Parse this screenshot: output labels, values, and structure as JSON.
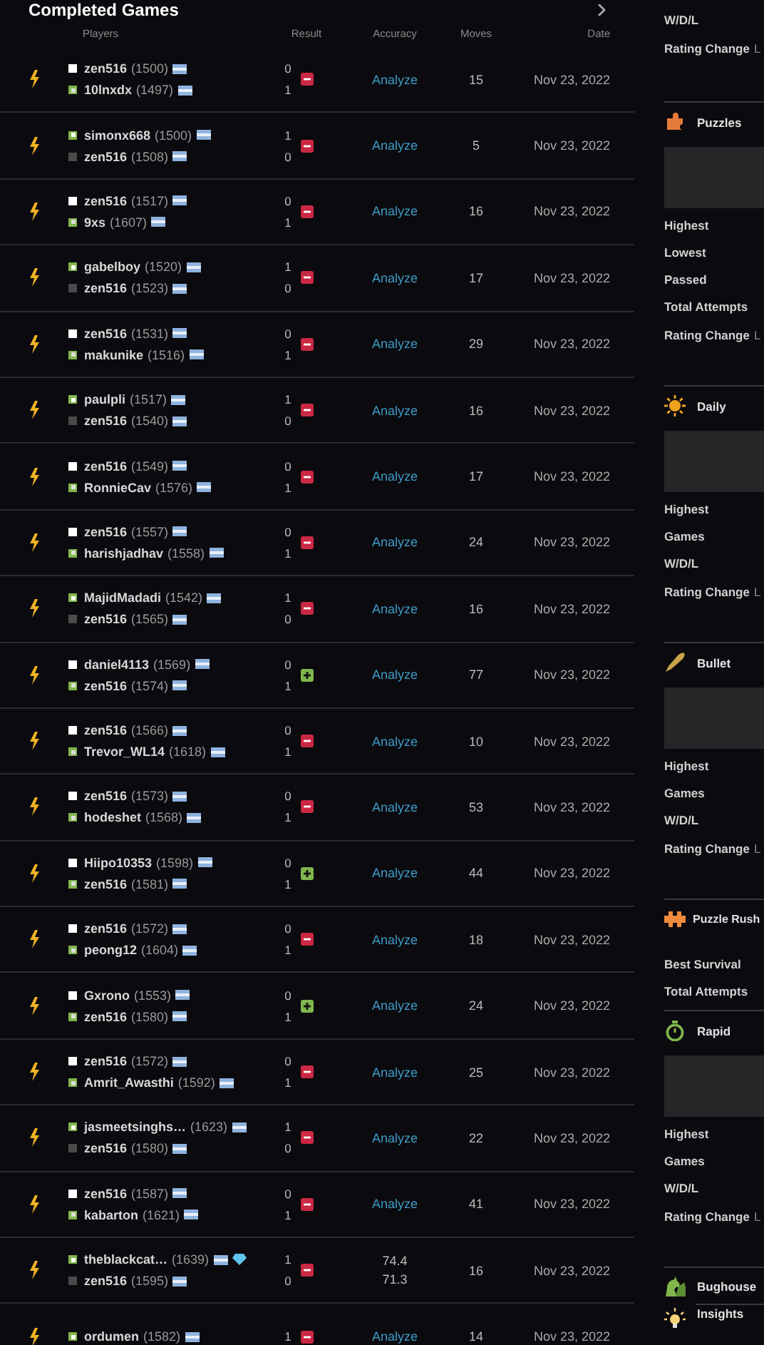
{
  "games_panel": {
    "title": "Completed Games",
    "columns": [
      "Players",
      "Result",
      "Accuracy",
      "Moves",
      "Date"
    ],
    "games": [
      {
        "kind": "blitz",
        "won": false,
        "players": [
          {
            "name": "zen516",
            "rating": "(1500)",
            "white": true,
            "winner": false,
            "diamond": false,
            "score": "0"
          },
          {
            "name": "10lnxdx",
            "rating": "(1497)",
            "white": false,
            "winner": true,
            "diamond": false,
            "score": "1"
          }
        ],
        "accuracy": {
          "kind": "link",
          "text": "Analyze"
        },
        "moves": "15",
        "date": "Nov 23, 2022"
      },
      {
        "kind": "blitz",
        "won": false,
        "players": [
          {
            "name": "simonx668",
            "rating": "(1500)",
            "white": true,
            "winner": true,
            "diamond": false,
            "score": "1"
          },
          {
            "name": "zen516",
            "rating": "(1508)",
            "white": false,
            "winner": false,
            "diamond": false,
            "score": "0"
          }
        ],
        "accuracy": {
          "kind": "link",
          "text": "Analyze"
        },
        "moves": "5",
        "date": "Nov 23, 2022"
      },
      {
        "kind": "blitz",
        "won": false,
        "players": [
          {
            "name": "zen516",
            "rating": "(1517)",
            "white": true,
            "winner": false,
            "diamond": false,
            "score": "0"
          },
          {
            "name": "9xs",
            "rating": "(1607)",
            "white": false,
            "winner": true,
            "diamond": false,
            "score": "1"
          }
        ],
        "accuracy": {
          "kind": "link",
          "text": "Analyze"
        },
        "moves": "16",
        "date": "Nov 23, 2022"
      },
      {
        "kind": "blitz",
        "won": false,
        "players": [
          {
            "name": "gabelboy",
            "rating": "(1520)",
            "white": true,
            "winner": true,
            "diamond": false,
            "score": "1"
          },
          {
            "name": "zen516",
            "rating": "(1523)",
            "white": false,
            "winner": false,
            "diamond": false,
            "score": "0"
          }
        ],
        "accuracy": {
          "kind": "link",
          "text": "Analyze"
        },
        "moves": "17",
        "date": "Nov 23, 2022"
      },
      {
        "kind": "blitz",
        "won": false,
        "players": [
          {
            "name": "zen516",
            "rating": "(1531)",
            "white": true,
            "winner": false,
            "diamond": false,
            "score": "0"
          },
          {
            "name": "makunike",
            "rating": "(1516)",
            "white": false,
            "winner": true,
            "diamond": false,
            "score": "1"
          }
        ],
        "accuracy": {
          "kind": "link",
          "text": "Analyze"
        },
        "moves": "29",
        "date": "Nov 23, 2022"
      },
      {
        "kind": "blitz",
        "won": false,
        "players": [
          {
            "name": "paulpli",
            "rating": "(1517)",
            "white": true,
            "winner": true,
            "diamond": false,
            "score": "1"
          },
          {
            "name": "zen516",
            "rating": "(1540)",
            "white": false,
            "winner": false,
            "diamond": false,
            "score": "0"
          }
        ],
        "accuracy": {
          "kind": "link",
          "text": "Analyze"
        },
        "moves": "16",
        "date": "Nov 23, 2022"
      },
      {
        "kind": "blitz",
        "won": false,
        "players": [
          {
            "name": "zen516",
            "rating": "(1549)",
            "white": true,
            "winner": false,
            "diamond": false,
            "score": "0"
          },
          {
            "name": "RonnieCav",
            "rating": "(1576)",
            "white": false,
            "winner": true,
            "diamond": false,
            "score": "1"
          }
        ],
        "accuracy": {
          "kind": "link",
          "text": "Analyze"
        },
        "moves": "17",
        "date": "Nov 23, 2022"
      },
      {
        "kind": "blitz",
        "won": false,
        "players": [
          {
            "name": "zen516",
            "rating": "(1557)",
            "white": true,
            "winner": false,
            "diamond": false,
            "score": "0"
          },
          {
            "name": "harishjadhav",
            "rating": "(1558)",
            "white": false,
            "winner": true,
            "diamond": false,
            "score": "1"
          }
        ],
        "accuracy": {
          "kind": "link",
          "text": "Analyze"
        },
        "moves": "24",
        "date": "Nov 23, 2022"
      },
      {
        "kind": "blitz",
        "won": false,
        "players": [
          {
            "name": "MajidMadadi",
            "rating": "(1542)",
            "white": true,
            "winner": true,
            "diamond": false,
            "score": "1"
          },
          {
            "name": "zen516",
            "rating": "(1565)",
            "white": false,
            "winner": false,
            "diamond": false,
            "score": "0"
          }
        ],
        "accuracy": {
          "kind": "link",
          "text": "Analyze"
        },
        "moves": "16",
        "date": "Nov 23, 2022"
      },
      {
        "kind": "blitz",
        "won": true,
        "players": [
          {
            "name": "daniel4113",
            "rating": "(1569)",
            "white": true,
            "winner": false,
            "diamond": false,
            "score": "0"
          },
          {
            "name": "zen516",
            "rating": "(1574)",
            "white": false,
            "winner": true,
            "diamond": false,
            "score": "1"
          }
        ],
        "accuracy": {
          "kind": "link",
          "text": "Analyze"
        },
        "moves": "77",
        "date": "Nov 23, 2022"
      },
      {
        "kind": "blitz",
        "won": false,
        "players": [
          {
            "name": "zen516",
            "rating": "(1566)",
            "white": true,
            "winner": false,
            "diamond": false,
            "score": "0"
          },
          {
            "name": "Trevor_WL14",
            "rating": "(1618)",
            "white": false,
            "winner": true,
            "diamond": false,
            "score": "1"
          }
        ],
        "accuracy": {
          "kind": "link",
          "text": "Analyze"
        },
        "moves": "10",
        "date": "Nov 23, 2022"
      },
      {
        "kind": "blitz",
        "won": false,
        "players": [
          {
            "name": "zen516",
            "rating": "(1573)",
            "white": true,
            "winner": false,
            "diamond": false,
            "score": "0"
          },
          {
            "name": "hodeshet",
            "rating": "(1568)",
            "white": false,
            "winner": true,
            "diamond": false,
            "score": "1"
          }
        ],
        "accuracy": {
          "kind": "link",
          "text": "Analyze"
        },
        "moves": "53",
        "date": "Nov 23, 2022"
      },
      {
        "kind": "blitz",
        "won": true,
        "players": [
          {
            "name": "Hiipo10353",
            "rating": "(1598)",
            "white": true,
            "winner": false,
            "diamond": false,
            "score": "0"
          },
          {
            "name": "zen516",
            "rating": "(1581)",
            "white": false,
            "winner": true,
            "diamond": false,
            "score": "1"
          }
        ],
        "accuracy": {
          "kind": "link",
          "text": "Analyze"
        },
        "moves": "44",
        "date": "Nov 23, 2022"
      },
      {
        "kind": "blitz",
        "won": false,
        "players": [
          {
            "name": "zen516",
            "rating": "(1572)",
            "white": true,
            "winner": false,
            "diamond": false,
            "score": "0"
          },
          {
            "name": "peong12",
            "rating": "(1604)",
            "white": false,
            "winner": true,
            "diamond": false,
            "score": "1"
          }
        ],
        "accuracy": {
          "kind": "link",
          "text": "Analyze"
        },
        "moves": "18",
        "date": "Nov 23, 2022"
      },
      {
        "kind": "blitz",
        "won": true,
        "players": [
          {
            "name": "Gxrono",
            "rating": "(1553)",
            "white": true,
            "winner": false,
            "diamond": false,
            "score": "0"
          },
          {
            "name": "zen516",
            "rating": "(1580)",
            "white": false,
            "winner": true,
            "diamond": false,
            "score": "1"
          }
        ],
        "accuracy": {
          "kind": "link",
          "text": "Analyze"
        },
        "moves": "24",
        "date": "Nov 23, 2022"
      },
      {
        "kind": "blitz",
        "won": false,
        "players": [
          {
            "name": "zen516",
            "rating": "(1572)",
            "white": true,
            "winner": false,
            "diamond": false,
            "score": "0"
          },
          {
            "name": "Amrit_Awasthi",
            "rating": "(1592)",
            "white": false,
            "winner": true,
            "diamond": false,
            "score": "1"
          }
        ],
        "accuracy": {
          "kind": "link",
          "text": "Analyze"
        },
        "moves": "25",
        "date": "Nov 23, 2022"
      },
      {
        "kind": "blitz",
        "won": false,
        "players": [
          {
            "name": "jasmeetsinghs…",
            "rating": "(1623)",
            "white": true,
            "winner": true,
            "diamond": false,
            "score": "1"
          },
          {
            "name": "zen516",
            "rating": "(1580)",
            "white": false,
            "winner": false,
            "diamond": false,
            "score": "0"
          }
        ],
        "accuracy": {
          "kind": "link",
          "text": "Analyze"
        },
        "moves": "22",
        "date": "Nov 23, 2022"
      },
      {
        "kind": "blitz",
        "won": false,
        "players": [
          {
            "name": "zen516",
            "rating": "(1587)",
            "white": true,
            "winner": false,
            "diamond": false,
            "score": "0"
          },
          {
            "name": "kabarton",
            "rating": "(1621)",
            "white": false,
            "winner": true,
            "diamond": false,
            "score": "1"
          }
        ],
        "accuracy": {
          "kind": "link",
          "text": "Analyze"
        },
        "moves": "41",
        "date": "Nov 23, 2022"
      },
      {
        "kind": "blitz",
        "won": false,
        "players": [
          {
            "name": "theblackcat…",
            "rating": "(1639)",
            "white": true,
            "winner": true,
            "diamond": true,
            "score": "1"
          },
          {
            "name": "zen516",
            "rating": "(1595)",
            "white": false,
            "winner": false,
            "diamond": false,
            "score": "0"
          }
        ],
        "accuracy": {
          "kind": "values",
          "values": [
            "74.4",
            "71.3"
          ]
        },
        "moves": "16",
        "date": "Nov 23, 2022"
      },
      {
        "kind": "blitz",
        "won": false,
        "players": [
          {
            "name": "ordumen",
            "rating": "(1582)",
            "white": true,
            "winner": true,
            "diamond": false,
            "score": "1"
          }
        ],
        "accuracy": {
          "kind": "link",
          "text": "Analyze"
        },
        "moves": "14",
        "date": "Nov 23, 2022"
      }
    ]
  },
  "sidebar": {
    "sections": [
      {
        "kind": "top",
        "graph": false,
        "stats": [
          "W/D/L"
        ],
        "rating_change": {
          "label": "Rating Change",
          "value": "L"
        }
      },
      {
        "kind": "puzzles",
        "title": "Puzzles",
        "graph": true,
        "stats": [
          "Highest",
          "Lowest",
          "Passed",
          "Total Attempts"
        ],
        "rating_change": {
          "label": "Rating Change",
          "value": "L"
        }
      },
      {
        "kind": "daily",
        "title": "Daily",
        "graph": true,
        "stats": [
          "Highest",
          "Games",
          "W/D/L"
        ],
        "rating_change": {
          "label": "Rating Change",
          "value": "L"
        }
      },
      {
        "kind": "bullet",
        "title": "Bullet",
        "graph": true,
        "stats": [
          "Highest",
          "Games",
          "W/D/L"
        ],
        "rating_change": {
          "label": "Rating Change",
          "value": "L"
        }
      },
      {
        "kind": "rush",
        "title": "Puzzle Rush",
        "graph": false,
        "stats": [
          "Best Survival",
          "Total Attempts"
        ]
      },
      {
        "kind": "rapid",
        "title": "Rapid",
        "graph": true,
        "stats": [
          "Highest",
          "Games",
          "W/D/L"
        ],
        "rating_change": {
          "label": "Rating Change",
          "value": "L"
        }
      },
      {
        "kind": "bughouse",
        "title": "Bughouse",
        "graph": false
      },
      {
        "kind": "insights",
        "title": "Insights",
        "graph": false
      }
    ]
  }
}
